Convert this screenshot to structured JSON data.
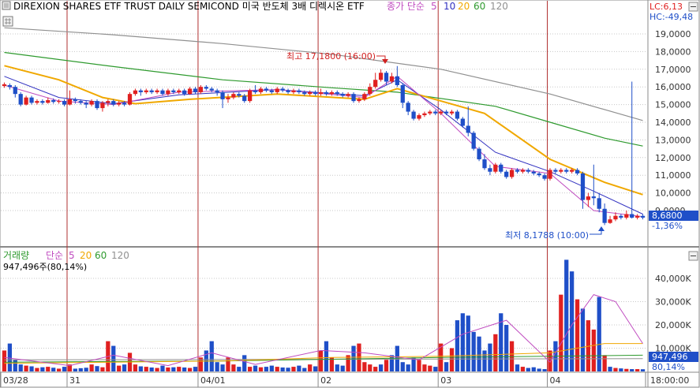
{
  "header": {
    "title": "DIREXION SHARES ETF TRUST DAILY SEMICOND  미국 반도체 3배 디렉시온 ETF",
    "ma_label": "종가 단순",
    "ma_periods": [
      "5",
      "10",
      "20",
      "60",
      "120"
    ],
    "lc": "LC:6,13",
    "hc": "HC:-49,48"
  },
  "volume_header": {
    "label": "거래량",
    "ma_label": "단순",
    "ma_periods": [
      "5",
      "20",
      "60",
      "120"
    ],
    "summary": "947,496주(80,14%)"
  },
  "annotations": {
    "high": "최고 17,1800 (16:00)",
    "low": "최저 8,1788 (10:00)"
  },
  "badges": {
    "price": "8,6800",
    "change": "-1,36%",
    "volume": "947,496",
    "volume_pct": "80,14%"
  },
  "colors": {
    "up": "#e02020",
    "down": "#1f4fc8",
    "ma5": "#c04cc0",
    "ma10": "#3030c0",
    "ma20": "#f0a800",
    "ma60": "#2e9a2e",
    "ma120": "#909090",
    "day_line": "#b03030",
    "grid": "#c8c8c8"
  },
  "chart_data": [
    {
      "type": "candlestick",
      "name": "price",
      "y_ticks": [
        "19,0000",
        "18,0000",
        "17,0000",
        "16,0000",
        "15,0000",
        "14,0000",
        "13,0000",
        "12,0000",
        "11,0000",
        "10,0000",
        "9,0000"
      ],
      "ylim": [
        7.5,
        19.9
      ],
      "x_ticks": [
        "03/28",
        "31",
        "04/01",
        "02",
        "03",
        "04",
        "18:00:00"
      ],
      "day_boundaries": [
        0,
        12,
        36,
        58,
        80,
        100,
        118
      ],
      "candles": [
        [
          16.05,
          16.15,
          16.25,
          15.95
        ],
        [
          16.1,
          16.0,
          16.2,
          15.85
        ],
        [
          16.0,
          15.6,
          16.1,
          15.4
        ],
        [
          15.6,
          15.0,
          15.7,
          14.9
        ],
        [
          15.0,
          15.4,
          15.5,
          14.95
        ],
        [
          15.4,
          15.1,
          15.5,
          15.0
        ],
        [
          15.1,
          15.2,
          15.3,
          15.0
        ],
        [
          15.2,
          15.1,
          15.3,
          15.0
        ],
        [
          15.1,
          15.25,
          15.4,
          15.05
        ],
        [
          15.25,
          15.15,
          15.35,
          15.05
        ],
        [
          15.15,
          15.2,
          15.3,
          15.05
        ],
        [
          15.2,
          15.0,
          15.3,
          14.9
        ],
        [
          15.0,
          15.3,
          15.8,
          14.95
        ],
        [
          15.3,
          15.2,
          15.4,
          15.05
        ],
        [
          15.2,
          15.1,
          15.3,
          15.0
        ],
        [
          15.1,
          15.0,
          15.2,
          14.8
        ],
        [
          15.0,
          15.2,
          15.3,
          14.9
        ],
        [
          15.2,
          14.8,
          15.3,
          14.7
        ],
        [
          14.8,
          15.1,
          15.2,
          14.6
        ],
        [
          15.1,
          15.2,
          15.3,
          14.9
        ],
        [
          15.2,
          15.0,
          15.3,
          14.9
        ],
        [
          15.0,
          15.1,
          15.2,
          14.9
        ],
        [
          15.1,
          15.0,
          15.2,
          14.9
        ],
        [
          15.0,
          15.6,
          15.7,
          14.95
        ],
        [
          15.6,
          15.8,
          15.9,
          15.5
        ],
        [
          15.8,
          15.7,
          15.9,
          15.5
        ],
        [
          15.7,
          15.8,
          15.9,
          15.6
        ],
        [
          15.8,
          15.7,
          15.9,
          15.6
        ],
        [
          15.7,
          15.8,
          15.9,
          15.6
        ],
        [
          15.8,
          15.6,
          15.9,
          15.5
        ],
        [
          15.6,
          15.8,
          15.9,
          15.5
        ],
        [
          15.8,
          15.7,
          15.9,
          15.6
        ],
        [
          15.7,
          15.8,
          15.9,
          15.6
        ],
        [
          15.8,
          15.6,
          15.9,
          15.5
        ],
        [
          15.6,
          15.9,
          16.0,
          15.55
        ],
        [
          15.9,
          15.7,
          16.0,
          15.6
        ],
        [
          15.7,
          16.0,
          16.1,
          15.6
        ],
        [
          16.0,
          15.9,
          16.1,
          15.8
        ],
        [
          15.9,
          15.8,
          16.0,
          15.7
        ],
        [
          15.8,
          15.7,
          15.9,
          15.5
        ],
        [
          15.7,
          15.3,
          15.8,
          14.8
        ],
        [
          15.3,
          15.4,
          15.6,
          15.1
        ],
        [
          15.4,
          15.6,
          15.7,
          15.3
        ],
        [
          15.6,
          15.5,
          15.7,
          15.4
        ],
        [
          15.5,
          15.2,
          15.6,
          15.1
        ],
        [
          15.2,
          15.8,
          15.9,
          15.1
        ],
        [
          15.8,
          15.7,
          16.1,
          15.6
        ],
        [
          15.7,
          15.9,
          16.0,
          15.6
        ],
        [
          15.9,
          15.8,
          16.0,
          15.7
        ],
        [
          15.8,
          15.7,
          15.9,
          15.6
        ],
        [
          15.7,
          15.9,
          16.0,
          15.6
        ],
        [
          15.9,
          15.8,
          16.0,
          15.7
        ],
        [
          15.8,
          15.7,
          15.9,
          15.6
        ],
        [
          15.7,
          15.8,
          15.9,
          15.6
        ],
        [
          15.8,
          15.7,
          15.9,
          15.6
        ],
        [
          15.7,
          15.6,
          15.8,
          15.5
        ],
        [
          15.6,
          15.7,
          15.8,
          15.5
        ],
        [
          15.7,
          15.6,
          15.8,
          15.5
        ],
        [
          15.6,
          15.7,
          15.9,
          15.5
        ],
        [
          15.7,
          15.6,
          15.8,
          15.5
        ],
        [
          15.6,
          15.7,
          15.8,
          15.5
        ],
        [
          15.7,
          15.6,
          15.8,
          15.5
        ],
        [
          15.6,
          15.5,
          15.7,
          15.4
        ],
        [
          15.5,
          15.6,
          15.7,
          15.4
        ],
        [
          15.6,
          15.2,
          15.7,
          15.1
        ],
        [
          15.2,
          15.3,
          15.4,
          15.1
        ],
        [
          15.3,
          15.6,
          15.7,
          15.2
        ],
        [
          15.6,
          16.0,
          16.2,
          15.5
        ],
        [
          16.0,
          16.4,
          16.8,
          15.9
        ],
        [
          16.4,
          16.8,
          17.0,
          16.3
        ],
        [
          16.8,
          16.3,
          16.9,
          16.1
        ],
        [
          16.3,
          16.6,
          16.8,
          16.2
        ],
        [
          16.6,
          16.1,
          17.18,
          16.0
        ],
        [
          16.1,
          15.1,
          16.2,
          14.8
        ],
        [
          15.1,
          14.6,
          15.2,
          14.4
        ],
        [
          14.6,
          14.2,
          14.7,
          14.1
        ],
        [
          14.2,
          14.4,
          14.5,
          14.1
        ],
        [
          14.4,
          14.5,
          14.6,
          14.3
        ],
        [
          14.5,
          14.6,
          14.7,
          14.4
        ],
        [
          14.6,
          14.5,
          14.7,
          14.4
        ],
        [
          14.5,
          14.6,
          14.7,
          14.4
        ],
        [
          14.6,
          14.5,
          14.7,
          14.4
        ],
        [
          14.5,
          14.6,
          14.7,
          14.4
        ],
        [
          14.6,
          14.2,
          14.7,
          14.1
        ],
        [
          14.2,
          13.8,
          14.3,
          13.7
        ],
        [
          13.8,
          13.4,
          14.9,
          13.2
        ],
        [
          13.4,
          12.5,
          13.5,
          12.4
        ],
        [
          12.5,
          11.9,
          12.6,
          11.8
        ],
        [
          11.9,
          11.4,
          12.2,
          11.3
        ],
        [
          11.4,
          11.2,
          11.6,
          11.0
        ],
        [
          11.2,
          11.6,
          11.7,
          11.1
        ],
        [
          11.6,
          11.2,
          11.7,
          11.1
        ],
        [
          11.2,
          10.9,
          11.3,
          10.8
        ],
        [
          10.9,
          11.3,
          11.4,
          10.8
        ],
        [
          11.3,
          11.2,
          11.4,
          11.1
        ],
        [
          11.2,
          11.3,
          11.4,
          11.1
        ],
        [
          11.3,
          11.2,
          11.4,
          11.1
        ],
        [
          11.2,
          11.1,
          11.3,
          11.0
        ],
        [
          11.1,
          11.0,
          11.2,
          10.9
        ],
        [
          11.0,
          10.8,
          11.1,
          10.7
        ],
        [
          10.8,
          11.3,
          11.4,
          10.7
        ],
        [
          11.3,
          11.2,
          11.4,
          11.1
        ],
        [
          11.2,
          11.3,
          11.4,
          11.1
        ],
        [
          11.3,
          11.2,
          11.4,
          11.1
        ],
        [
          11.2,
          11.3,
          11.4,
          11.1
        ],
        [
          11.3,
          11.1,
          11.4,
          11.0
        ],
        [
          11.1,
          9.6,
          11.2,
          9.1
        ],
        [
          9.6,
          9.8,
          10.0,
          9.2
        ],
        [
          9.8,
          9.7,
          11.6,
          9.3
        ],
        [
          9.7,
          9.1,
          10.0,
          8.9
        ],
        [
          9.1,
          8.3,
          9.4,
          8.18
        ],
        [
          8.3,
          8.5,
          8.7,
          8.25
        ],
        [
          8.5,
          8.7,
          8.9,
          8.4
        ],
        [
          8.7,
          8.6,
          8.8,
          8.5
        ],
        [
          8.6,
          8.8,
          9.0,
          8.5
        ],
        [
          8.8,
          8.6,
          16.3,
          8.55
        ],
        [
          8.6,
          8.7,
          8.8,
          8.5
        ],
        [
          8.7,
          8.6,
          8.8,
          8.5
        ]
      ],
      "ma120": [
        [
          0,
          19.35
        ],
        [
          20,
          18.95
        ],
        [
          40,
          18.45
        ],
        [
          60,
          17.85
        ],
        [
          80,
          17.0
        ],
        [
          100,
          15.6
        ],
        [
          117,
          14.1
        ]
      ],
      "ma60": [
        [
          0,
          17.95
        ],
        [
          20,
          17.15
        ],
        [
          40,
          16.4
        ],
        [
          60,
          15.95
        ],
        [
          72,
          15.7
        ],
        [
          90,
          14.9
        ],
        [
          100,
          14.0
        ],
        [
          110,
          13.1
        ],
        [
          117,
          12.65
        ]
      ],
      "ma20": [
        [
          0,
          17.2
        ],
        [
          10,
          16.4
        ],
        [
          18,
          15.4
        ],
        [
          24,
          15.05
        ],
        [
          34,
          15.3
        ],
        [
          50,
          15.6
        ],
        [
          66,
          15.3
        ],
        [
          72,
          15.9
        ],
        [
          80,
          15.2
        ],
        [
          88,
          14.5
        ],
        [
          100,
          11.9
        ],
        [
          110,
          10.6
        ],
        [
          117,
          9.9
        ]
      ],
      "ma10": [
        [
          0,
          16.6
        ],
        [
          10,
          15.4
        ],
        [
          20,
          15.05
        ],
        [
          32,
          15.55
        ],
        [
          50,
          15.85
        ],
        [
          66,
          15.5
        ],
        [
          72,
          16.4
        ],
        [
          80,
          14.7
        ],
        [
          90,
          12.3
        ],
        [
          100,
          11.2
        ],
        [
          108,
          10.1
        ],
        [
          117,
          8.8
        ]
      ],
      "ma5": [
        [
          0,
          16.1
        ],
        [
          10,
          15.2
        ],
        [
          20,
          15.0
        ],
        [
          32,
          15.7
        ],
        [
          50,
          15.85
        ],
        [
          66,
          15.4
        ],
        [
          72,
          16.6
        ],
        [
          80,
          14.5
        ],
        [
          90,
          11.5
        ],
        [
          100,
          11.1
        ],
        [
          108,
          9.0
        ],
        [
          117,
          8.65
        ]
      ]
    },
    {
      "type": "bar",
      "name": "volume",
      "y_ticks": [
        "40,000K",
        "30,000K",
        "20,000K",
        "10,000K"
      ],
      "ylim": [
        0,
        49000
      ],
      "x_ticks": [
        "03/28",
        "31",
        "04/01",
        "02",
        "03",
        "04",
        "18:00:00"
      ],
      "values": [
        9000,
        12000,
        5000,
        3000,
        2500,
        2200,
        1500,
        1800,
        2000,
        1600,
        1200,
        2000,
        3000,
        1200,
        1400,
        1600,
        3000,
        2300,
        1800,
        13000,
        11000,
        2500,
        3000,
        8000,
        3000,
        2200,
        2000,
        1700,
        1500,
        2500,
        1700,
        1800,
        2000,
        1700,
        1500,
        2000,
        6000,
        9000,
        13000,
        4000,
        3000,
        6000,
        3000,
        2000,
        7000,
        2000,
        2500,
        1800,
        2000,
        2500,
        2000,
        1700,
        1600,
        2000,
        2500,
        1500,
        3000,
        2200,
        9000,
        13000,
        6000,
        3000,
        2500,
        7000,
        11000,
        12000,
        4000,
        3000,
        2000,
        3000,
        5000,
        7000,
        11000,
        4000,
        3000,
        6000,
        5000,
        3000,
        2500,
        2000,
        12000,
        4000,
        10000,
        22000,
        25000,
        24000,
        17000,
        15000,
        9000,
        12000,
        16000,
        25000,
        20000,
        13000,
        3000,
        2000,
        1500,
        1800,
        1200,
        1000,
        9000,
        13000,
        33000,
        48000,
        43000,
        31000,
        27000,
        22000,
        18000,
        32000,
        7000,
        2000,
        1500,
        1300,
        1100,
        1000,
        1000,
        947
      ],
      "up": [
        1,
        0,
        0,
        0,
        1,
        0,
        1,
        0,
        1,
        0,
        1,
        0,
        1,
        0,
        0,
        0,
        1,
        0,
        1,
        1,
        0,
        1,
        0,
        1,
        1,
        0,
        1,
        0,
        1,
        0,
        1,
        0,
        1,
        0,
        1,
        0,
        1,
        0,
        0,
        0,
        0,
        1,
        1,
        0,
        0,
        1,
        0,
        1,
        0,
        0,
        1,
        0,
        0,
        1,
        0,
        0,
        1,
        0,
        1,
        0,
        1,
        0,
        0,
        1,
        0,
        1,
        1,
        1,
        1,
        0,
        1,
        0,
        0,
        0,
        0,
        0,
        1,
        1,
        1,
        0,
        1,
        0,
        1,
        0,
        0,
        0,
        0,
        0,
        0,
        0,
        1,
        0,
        0,
        1,
        0,
        1,
        0,
        0,
        0,
        0,
        1,
        0,
        1,
        0,
        0,
        1,
        0,
        1,
        1,
        0,
        1,
        0,
        1,
        0,
        1,
        0,
        1,
        0
      ],
      "ma5_vol": [
        [
          0,
          6000
        ],
        [
          12,
          2500
        ],
        [
          20,
          7000
        ],
        [
          30,
          2500
        ],
        [
          38,
          8000
        ],
        [
          46,
          3000
        ],
        [
          58,
          9000
        ],
        [
          66,
          8000
        ],
        [
          76,
          5000
        ],
        [
          84,
          16000
        ],
        [
          92,
          22000
        ],
        [
          100,
          4000
        ],
        [
          104,
          20000
        ],
        [
          108,
          33000
        ],
        [
          112,
          30000
        ],
        [
          117,
          12000
        ]
      ],
      "ma20_vol": [
        [
          0,
          3500
        ],
        [
          20,
          4000
        ],
        [
          40,
          4500
        ],
        [
          60,
          6000
        ],
        [
          80,
          6500
        ],
        [
          100,
          8000
        ],
        [
          110,
          12000
        ],
        [
          117,
          12000
        ]
      ],
      "ma60_vol": [
        [
          0,
          4000
        ],
        [
          40,
          4500
        ],
        [
          80,
          6000
        ],
        [
          117,
          7000
        ]
      ],
      "ma120_vol": [
        [
          0,
          5000
        ],
        [
          117,
          5500
        ]
      ]
    }
  ]
}
